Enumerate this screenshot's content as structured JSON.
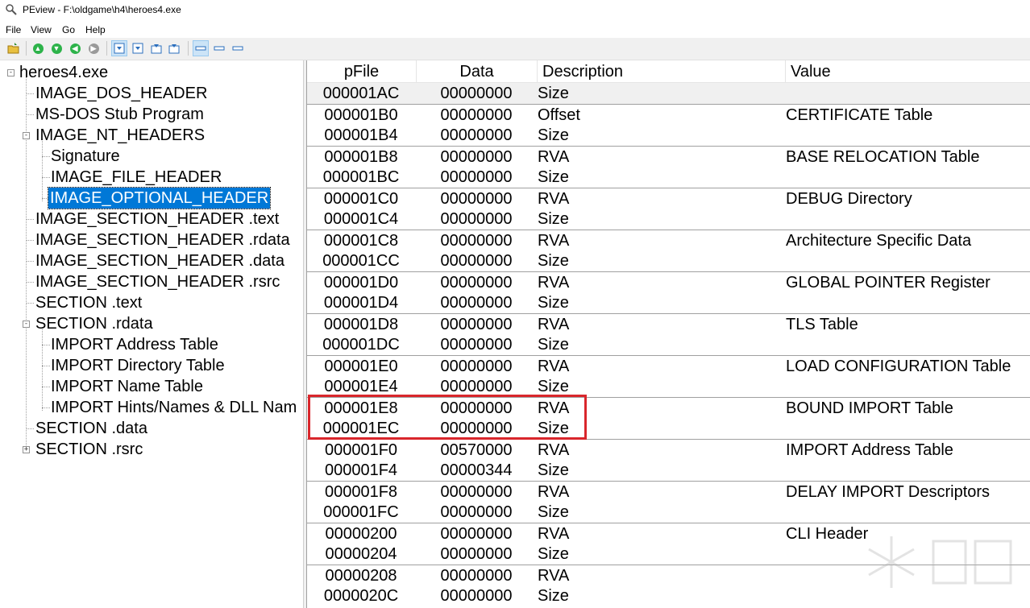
{
  "window": {
    "title": "PEview - F:\\oldgame\\h4\\heroes4.exe"
  },
  "menu": [
    "File",
    "View",
    "Go",
    "Help"
  ],
  "toolbar": {
    "buttons": [
      "open-icon",
      "back-icon",
      "forward-icon",
      "previous-icon",
      "next-icon",
      "view-byte-icon",
      "view-word-icon",
      "view-dword-icon",
      "view-qword-icon",
      "view-mode-a-icon",
      "view-mode-b-icon",
      "view-mode-c-icon"
    ]
  },
  "tree": {
    "items": [
      {
        "label": "heroes4.exe",
        "level": 0,
        "expander": "-"
      },
      {
        "label": "IMAGE_DOS_HEADER",
        "level": 1
      },
      {
        "label": "MS-DOS Stub Program",
        "level": 1
      },
      {
        "label": "IMAGE_NT_HEADERS",
        "level": 1,
        "expander": "-"
      },
      {
        "label": "Signature",
        "level": 2
      },
      {
        "label": "IMAGE_FILE_HEADER",
        "level": 2
      },
      {
        "label": "IMAGE_OPTIONAL_HEADER",
        "level": 2,
        "selected": true
      },
      {
        "label": "IMAGE_SECTION_HEADER .text",
        "level": 1
      },
      {
        "label": "IMAGE_SECTION_HEADER .rdata",
        "level": 1
      },
      {
        "label": "IMAGE_SECTION_HEADER .data",
        "level": 1
      },
      {
        "label": "IMAGE_SECTION_HEADER .rsrc",
        "level": 1
      },
      {
        "label": "SECTION .text",
        "level": 1
      },
      {
        "label": "SECTION .rdata",
        "level": 1,
        "expander": "-"
      },
      {
        "label": "IMPORT Address Table",
        "level": 2
      },
      {
        "label": "IMPORT Directory Table",
        "level": 2
      },
      {
        "label": "IMPORT Name Table",
        "level": 2
      },
      {
        "label": "IMPORT Hints/Names & DLL Nam",
        "level": 2
      },
      {
        "label": "SECTION .data",
        "level": 1
      },
      {
        "label": "SECTION .rsrc",
        "level": 1,
        "expander": "+"
      }
    ]
  },
  "list": {
    "columns": [
      "pFile",
      "Data",
      "Description",
      "Value"
    ],
    "rows": [
      {
        "pfile": "000001AC",
        "data": "00000000",
        "desc": "Size",
        "value": ""
      },
      {
        "pfile": "000001B0",
        "data": "00000000",
        "desc": "Offset",
        "value": "CERTIFICATE Table"
      },
      {
        "pfile": "000001B4",
        "data": "00000000",
        "desc": "Size",
        "value": ""
      },
      {
        "pfile": "000001B8",
        "data": "00000000",
        "desc": "RVA",
        "value": "BASE RELOCATION Table"
      },
      {
        "pfile": "000001BC",
        "data": "00000000",
        "desc": "Size",
        "value": ""
      },
      {
        "pfile": "000001C0",
        "data": "00000000",
        "desc": "RVA",
        "value": "DEBUG Directory"
      },
      {
        "pfile": "000001C4",
        "data": "00000000",
        "desc": "Size",
        "value": ""
      },
      {
        "pfile": "000001C8",
        "data": "00000000",
        "desc": "RVA",
        "value": "Architecture Specific Data"
      },
      {
        "pfile": "000001CC",
        "data": "00000000",
        "desc": "Size",
        "value": ""
      },
      {
        "pfile": "000001D0",
        "data": "00000000",
        "desc": "RVA",
        "value": "GLOBAL POINTER Register"
      },
      {
        "pfile": "000001D4",
        "data": "00000000",
        "desc": "Size",
        "value": ""
      },
      {
        "pfile": "000001D8",
        "data": "00000000",
        "desc": "RVA",
        "value": "TLS Table"
      },
      {
        "pfile": "000001DC",
        "data": "00000000",
        "desc": "Size",
        "value": ""
      },
      {
        "pfile": "000001E0",
        "data": "00000000",
        "desc": "RVA",
        "value": "LOAD CONFIGURATION Table"
      },
      {
        "pfile": "000001E4",
        "data": "00000000",
        "desc": "Size",
        "value": ""
      },
      {
        "pfile": "000001E8",
        "data": "00000000",
        "desc": "RVA",
        "value": "BOUND IMPORT Table"
      },
      {
        "pfile": "000001EC",
        "data": "00000000",
        "desc": "Size",
        "value": ""
      },
      {
        "pfile": "000001F0",
        "data": "00570000",
        "desc": "RVA",
        "value": "IMPORT Address Table"
      },
      {
        "pfile": "000001F4",
        "data": "00000344",
        "desc": "Size",
        "value": ""
      },
      {
        "pfile": "000001F8",
        "data": "00000000",
        "desc": "RVA",
        "value": "DELAY IMPORT Descriptors"
      },
      {
        "pfile": "000001FC",
        "data": "00000000",
        "desc": "Size",
        "value": ""
      },
      {
        "pfile": "00000200",
        "data": "00000000",
        "desc": "RVA",
        "value": "CLI Header"
      },
      {
        "pfile": "00000204",
        "data": "00000000",
        "desc": "Size",
        "value": ""
      },
      {
        "pfile": "00000208",
        "data": "00000000",
        "desc": "RVA",
        "value": ""
      },
      {
        "pfile": "0000020C",
        "data": "00000000",
        "desc": "Size",
        "value": ""
      }
    ],
    "highlighted_rows": [
      "000001E8",
      "000001EC"
    ]
  },
  "colors": {
    "selection": "#0078d7",
    "highlight_box": "#d9262c",
    "nav_green": "#2db34a",
    "nav_gray": "#9a9a9a"
  }
}
